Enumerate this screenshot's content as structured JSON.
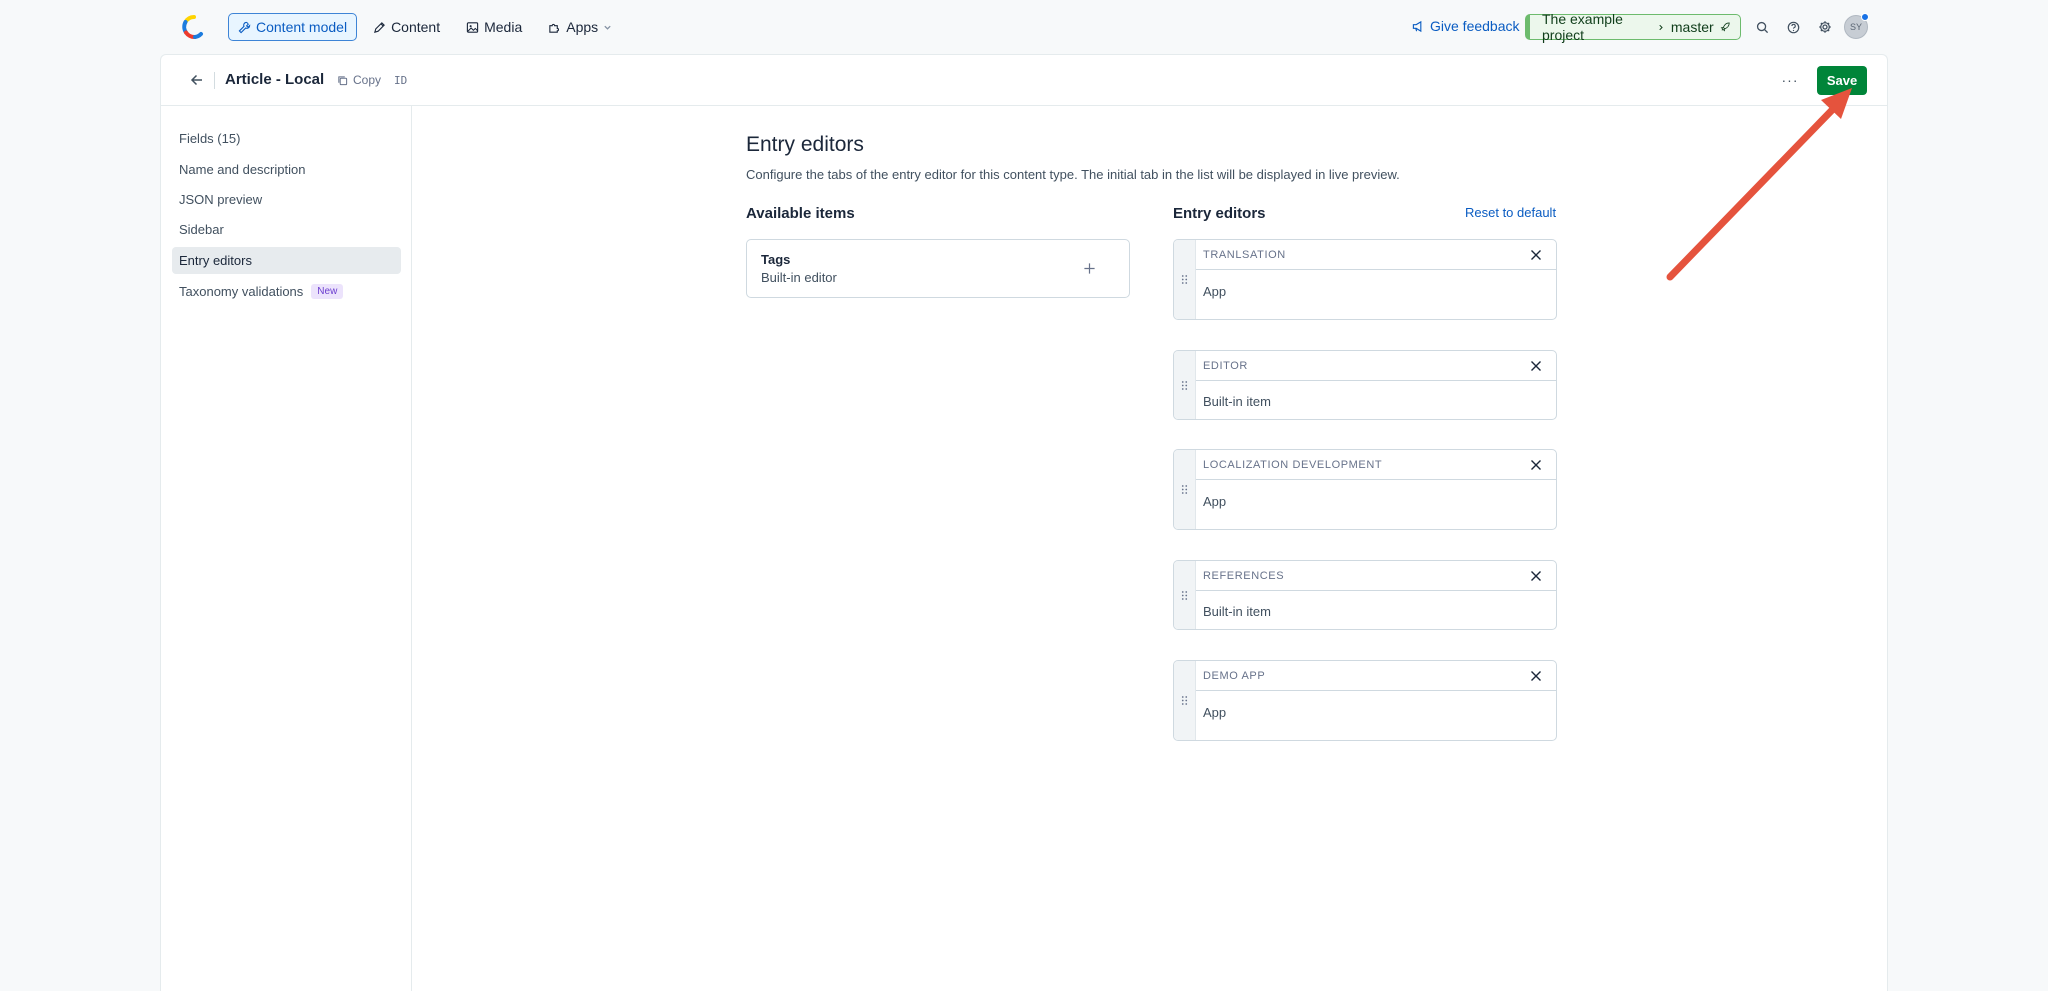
{
  "topnav": {
    "items": [
      {
        "label": "Content model",
        "icon": "wrench-icon",
        "active": true
      },
      {
        "label": "Content",
        "icon": "pen-icon",
        "active": false
      },
      {
        "label": "Media",
        "icon": "image-icon",
        "active": false
      },
      {
        "label": "Apps",
        "icon": "puzzle-icon",
        "active": false
      }
    ],
    "feedback_label": "Give feedback",
    "project": "The example project",
    "environment": "master",
    "avatar_initials": "SY"
  },
  "header": {
    "title": "Article - Local",
    "copy_label": "Copy",
    "id_label": "ID",
    "more_label": "···",
    "save_label": "Save"
  },
  "sidebar": {
    "items": [
      {
        "label": "Fields (15)",
        "active": false
      },
      {
        "label": "Name and description",
        "active": false
      },
      {
        "label": "JSON preview",
        "active": false
      },
      {
        "label": "Sidebar",
        "active": false
      },
      {
        "label": "Entry editors",
        "active": true
      },
      {
        "label": "Taxonomy validations",
        "active": false,
        "badge": "New"
      }
    ]
  },
  "main": {
    "title": "Entry editors",
    "description": "Configure the tabs of the entry editor for this content type. The initial tab in the list will be displayed in live preview.",
    "available": {
      "title": "Available items",
      "items": [
        {
          "name": "Tags",
          "type": "Built-in editor"
        }
      ]
    },
    "editors": {
      "title": "Entry editors",
      "reset_label": "Reset to default",
      "items": [
        {
          "name": "TRANLSATION",
          "type": "App"
        },
        {
          "name": "EDITOR",
          "type": "Built-in item"
        },
        {
          "name": "LOCALIZATION DEVELOPMENT",
          "type": "App"
        },
        {
          "name": "REFERENCES",
          "type": "Built-in item"
        },
        {
          "name": "DEMO APP",
          "type": "App"
        }
      ]
    }
  },
  "colors": {
    "accent": "#0a5cc2",
    "save": "#008539",
    "annotation_arrow": "#e5533d"
  }
}
